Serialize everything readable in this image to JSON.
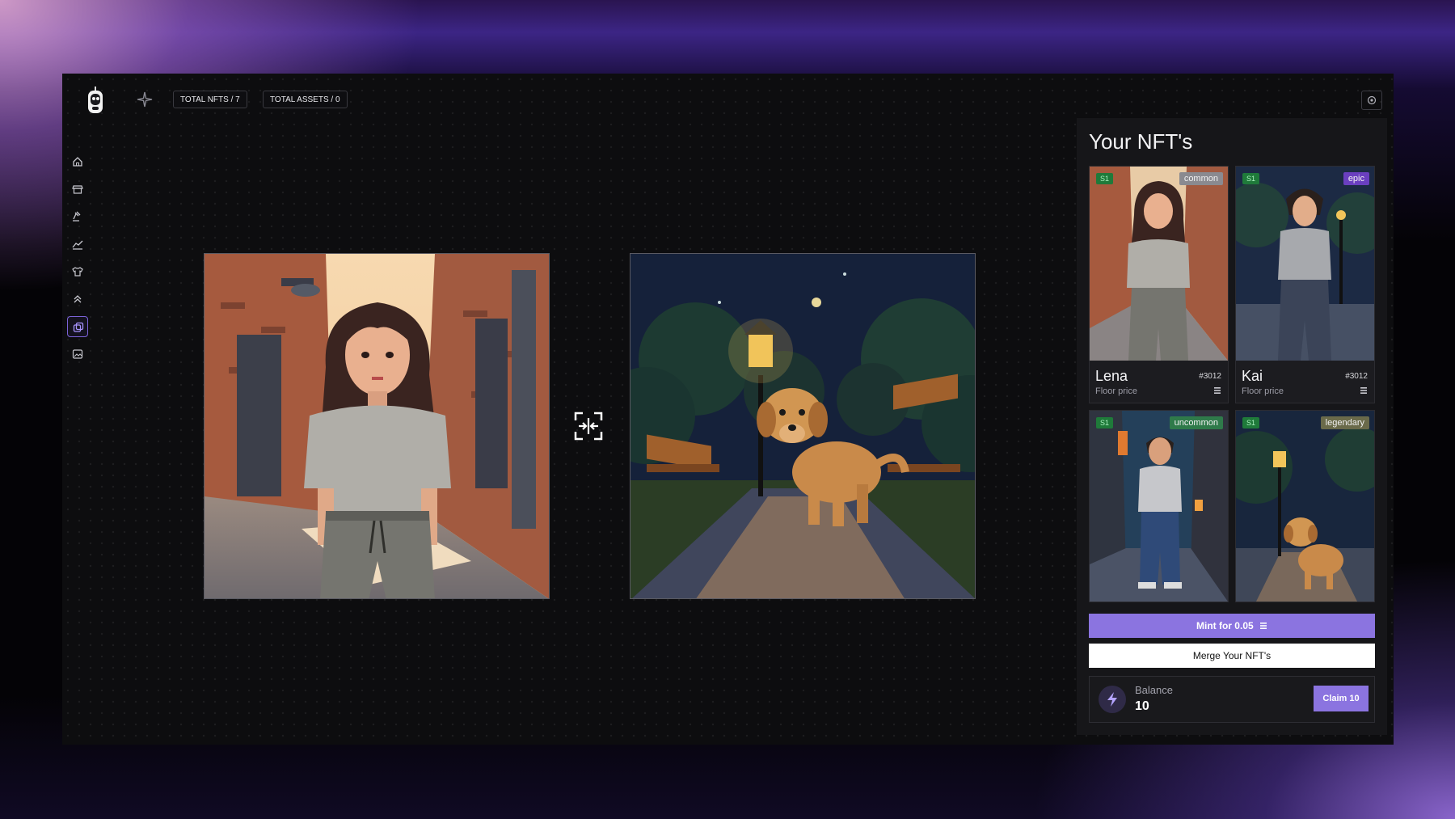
{
  "topbar": {
    "total_nfts": "TOTAL NFTS / 7",
    "total_assets": "TOTAL ASSETS / 0"
  },
  "sidebar": {
    "items": [
      {
        "icon": "home-icon",
        "active": false
      },
      {
        "icon": "store-icon",
        "active": false
      },
      {
        "icon": "auction-hammer-icon",
        "active": false
      },
      {
        "icon": "chart-icon",
        "active": false
      },
      {
        "icon": "shirt-icon",
        "active": false
      },
      {
        "icon": "chevrons-up-icon",
        "active": false
      },
      {
        "icon": "merge-layers-icon",
        "active": true
      },
      {
        "icon": "gallery-icon",
        "active": false
      }
    ]
  },
  "merge": {
    "left_art": "pixel-art woman in alley",
    "right_art": "pixel-art dog in park at night",
    "merge_icon": "merge-arrows-icon"
  },
  "panel": {
    "title": "Your NFT's",
    "cards": [
      {
        "season": "S1",
        "rarity": "common",
        "name": "Lena",
        "id": "#3012",
        "floor_label": "Floor price",
        "rarity_color": "#8a8a90"
      },
      {
        "season": "S1",
        "rarity": "epic",
        "name": "Kai",
        "id": "#3012",
        "floor_label": "Floor price",
        "rarity_color": "#6a3fbf"
      },
      {
        "season": "S1",
        "rarity": "uncommon",
        "rarity_color": "#2f7a4a"
      },
      {
        "season": "S1",
        "rarity": "legendary",
        "rarity_color": "#6a6a4a"
      }
    ],
    "mint_label": "Mint for 0.05",
    "merge_label": "Merge Your NFT's",
    "balance_label": "Balance",
    "balance_value": "10",
    "claim_label": "Claim 10",
    "accent": "#8b74e0"
  }
}
